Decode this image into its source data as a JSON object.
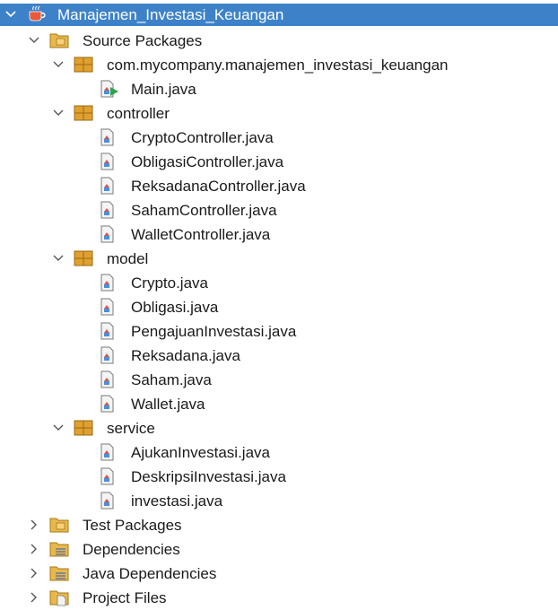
{
  "tree": {
    "project": {
      "label": "Manajemen_Investasi_Keuangan",
      "icon": "java-project-icon",
      "expanded": true,
      "selected": true
    },
    "source_packages": {
      "label": "Source Packages",
      "icon": "source-packages-folder-icon",
      "expanded": true,
      "packages": [
        {
          "label": "com.mycompany.manajemen_investasi_keuangan",
          "files": [
            "Main.java"
          ]
        },
        {
          "label": "controller",
          "files": [
            "CryptoController.java",
            "ObligasiController.java",
            "ReksadanaController.java",
            "SahamController.java",
            "WalletController.java"
          ]
        },
        {
          "label": "model",
          "files": [
            "Crypto.java",
            "Obligasi.java",
            "PengajuanInvestasi.java",
            "Reksadana.java",
            "Saham.java",
            "Wallet.java"
          ]
        },
        {
          "label": "service",
          "files": [
            "AjukanInvestasi.java",
            "DeskripsiInvestasi.java",
            "investasi.java"
          ]
        }
      ]
    },
    "test_packages": {
      "label": "Test Packages",
      "icon": "test-packages-folder-icon",
      "expanded": false
    },
    "dependencies": {
      "label": "Dependencies",
      "icon": "dependencies-folder-icon",
      "expanded": false
    },
    "java_dependencies": {
      "label": "Java Dependencies",
      "icon": "java-dependencies-folder-icon",
      "expanded": false
    },
    "project_files": {
      "label": "Project Files",
      "icon": "project-files-folder-icon",
      "expanded": false
    }
  },
  "colors": {
    "selection": "#3d82c9",
    "package": "#e0a030",
    "folder": "#e8b84a"
  }
}
